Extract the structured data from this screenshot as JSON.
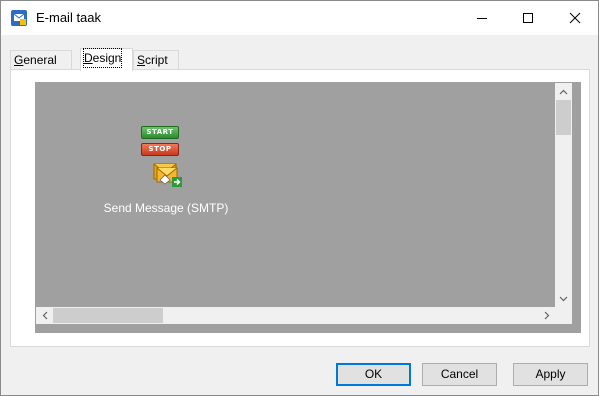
{
  "window": {
    "title": "E-mail taak",
    "icon": "app-icon"
  },
  "titlebar_buttons": {
    "minimize": "minimize-icon",
    "maximize": "maximize-icon",
    "close": "close-icon"
  },
  "tabs": [
    {
      "label": "General",
      "accesskey": "G",
      "active": false
    },
    {
      "label": "Design",
      "accesskey": "D",
      "active": true
    },
    {
      "label": "Script",
      "accesskey": "S",
      "active": false
    }
  ],
  "flow": {
    "start_label": "START",
    "stop_label": "STOP",
    "node_label": "Send Message (SMTP)",
    "node_icon": "envelope-send-icon"
  },
  "buttons": {
    "ok": "OK",
    "cancel": "Cancel",
    "apply": "Apply"
  },
  "colors": {
    "canvas_background": "#a0a0a0",
    "start_green": "#2e8b2e",
    "stop_red": "#c93a1e",
    "focus_blue": "#0078d7"
  }
}
